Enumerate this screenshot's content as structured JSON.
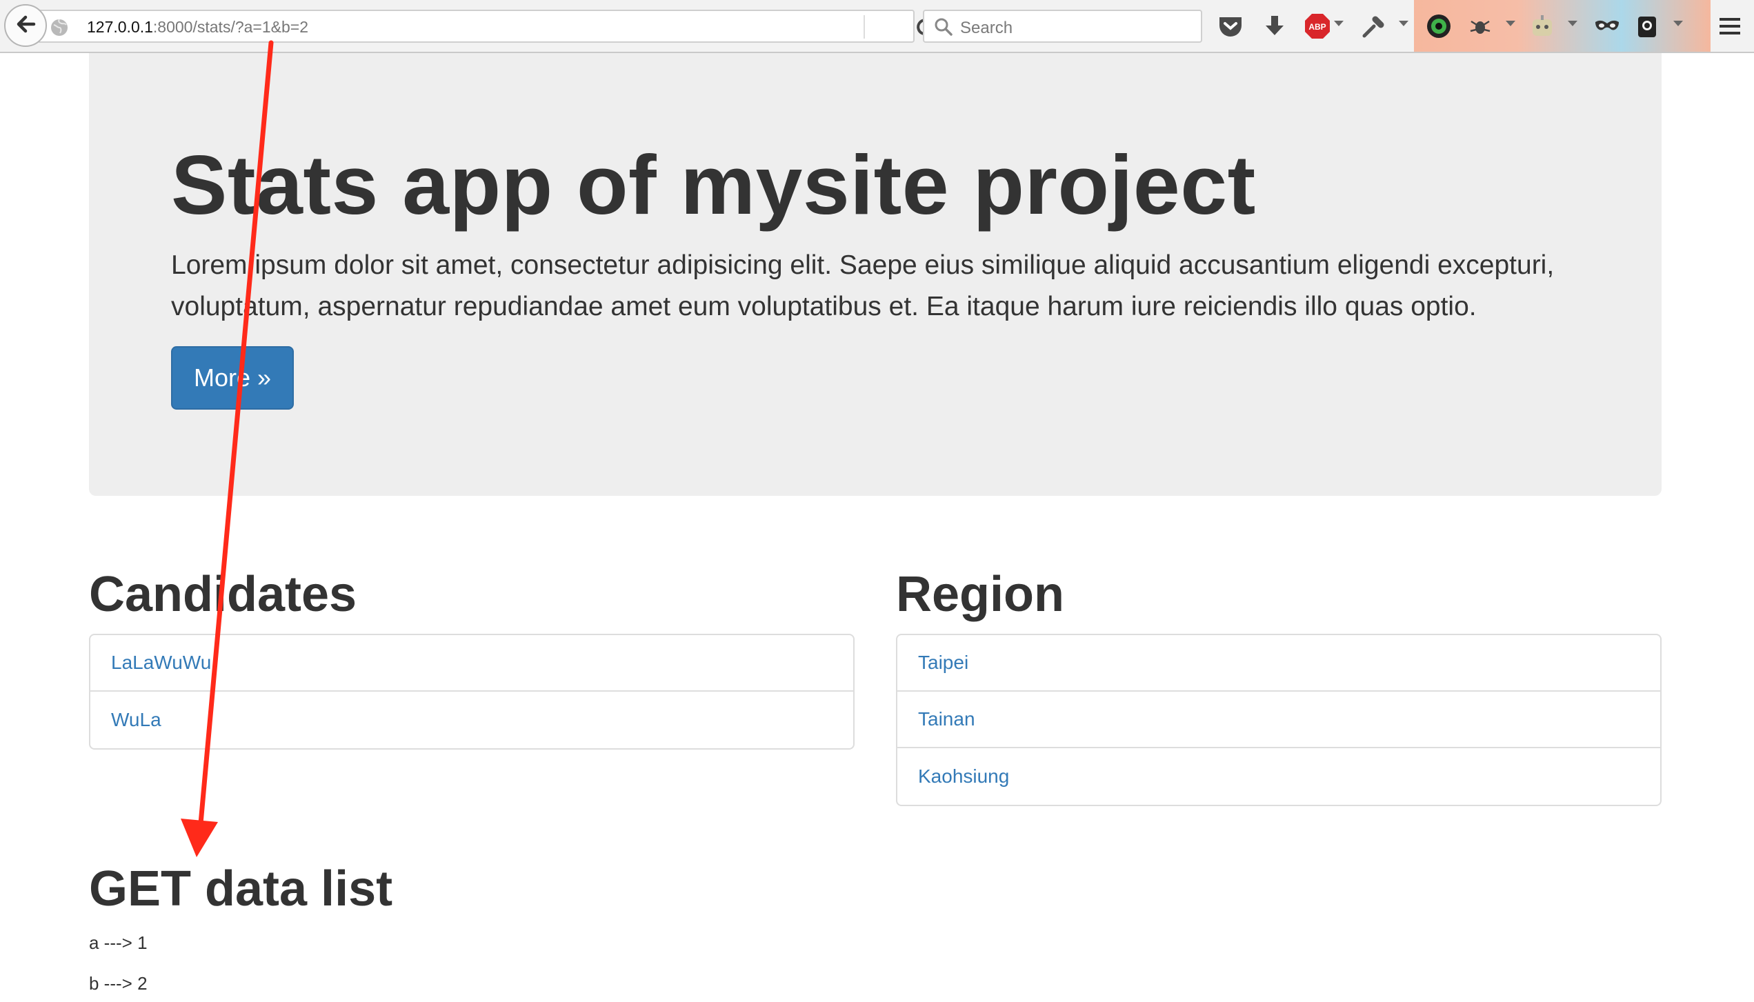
{
  "browser": {
    "url_host": "127.0.0.1",
    "url_rest": ":8000/stats/?a=1&b=2",
    "search_placeholder": "Search",
    "icons": [
      "back-arrow-icon",
      "globe-icon",
      "reload-icon",
      "search-icon",
      "pocket-icon",
      "download-icon",
      "adblock-icon",
      "eyedropper-icon",
      "color-wheel-icon",
      "bug-icon",
      "robot-icon",
      "mask-icon",
      "camera-icon",
      "menu-icon"
    ],
    "adblock_label": "ABP"
  },
  "hero": {
    "title": "Stats app of mysite project",
    "text": "Lorem ipsum dolor sit amet, consectetur adipisicing elit. Saepe eius similique aliquid accusantium eligendi excepturi, voluptatum, aspernatur repudiandae amet eum voluptatibus et. Ea itaque harum iure reiciendis illo quas optio.",
    "button_label": "More »"
  },
  "candidates": {
    "heading": "Candidates",
    "items": [
      "LaLaWuWu",
      "WuLa"
    ]
  },
  "region": {
    "heading": "Region",
    "items": [
      "Taipei",
      "Tainan",
      "Kaohsiung"
    ]
  },
  "get_data": {
    "heading": "GET data list",
    "lines": [
      "a ---> 1",
      "b ---> 2"
    ]
  },
  "colors": {
    "link": "#337ab7",
    "button": "#337ab7",
    "jumbotron_bg": "#eeeeee",
    "annotation_arrow": "#ff2a1a"
  }
}
